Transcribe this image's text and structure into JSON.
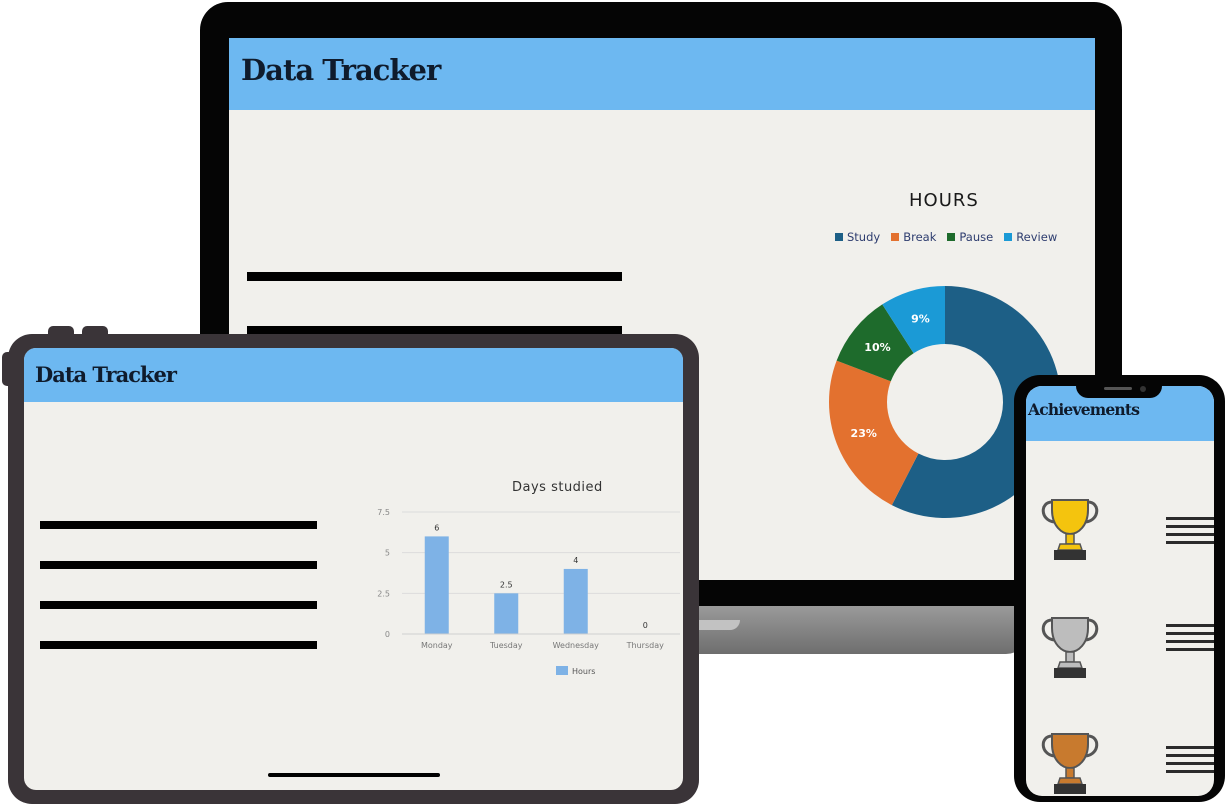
{
  "laptop": {
    "title": "Data Tracker",
    "donut_chart": {
      "title": "HOURS",
      "legend": [
        {
          "label": "Study",
          "color": "#1d5f86"
        },
        {
          "label": "Break",
          "color": "#e3712f"
        },
        {
          "label": "Pause",
          "color": "#1e6b2c"
        },
        {
          "label": "Review",
          "color": "#1b9ad6"
        }
      ]
    }
  },
  "tablet": {
    "title": "Data Tracker",
    "bar_chart": {
      "title": "Days studied",
      "y_ticks": [
        "0",
        "2.5",
        "5",
        "7.5"
      ],
      "legend_label": "Hours",
      "bar_color": "#7eb2e6"
    }
  },
  "phone": {
    "title": "Achievements",
    "trophies": [
      {
        "icon": "gold-trophy-icon",
        "color": "#f4c40e"
      },
      {
        "icon": "silver-trophy-icon",
        "color": "#bdbdbd"
      },
      {
        "icon": "bronze-trophy-icon",
        "color": "#c87a2e"
      }
    ]
  },
  "chart_data": [
    {
      "type": "pie",
      "title": "HOURS",
      "categories": [
        "Study",
        "Break",
        "Pause",
        "Review"
      ],
      "values": [
        57,
        23,
        10,
        9
      ],
      "value_labels": [
        "",
        "23%",
        "10%",
        "9%"
      ],
      "colors": [
        "#1d5f86",
        "#e3712f",
        "#1e6b2c",
        "#1b9ad6"
      ],
      "legend_position": "top"
    },
    {
      "type": "bar",
      "title": "Days studied",
      "categories": [
        "Monday",
        "Tuesday",
        "Wednesday",
        "Thursday"
      ],
      "series": [
        {
          "name": "Hours",
          "values": [
            6,
            2.5,
            4,
            0
          ]
        }
      ],
      "value_labels": [
        "6",
        "2.5",
        "4",
        "0"
      ],
      "ylim": [
        0,
        7.5
      ],
      "y_ticks": [
        0,
        2.5,
        5,
        7.5
      ],
      "grid": true,
      "legend_position": "bottom"
    }
  ]
}
